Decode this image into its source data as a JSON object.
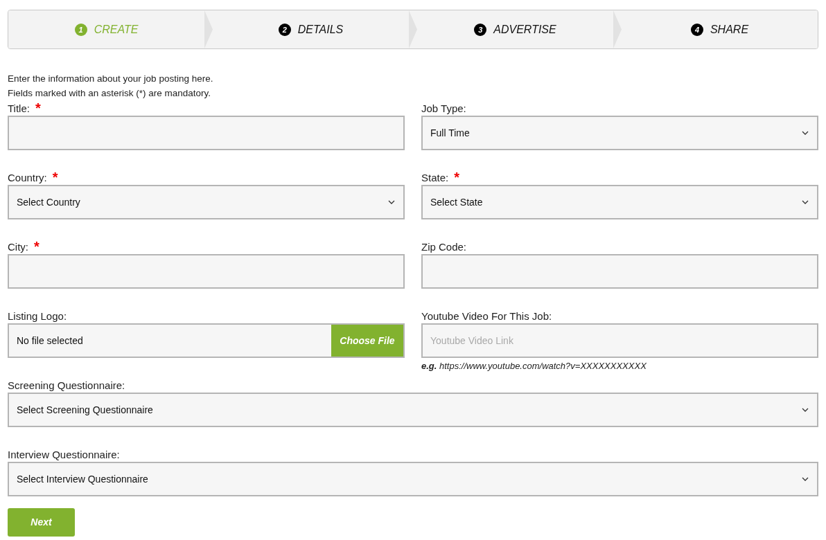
{
  "steps": [
    {
      "number": "1",
      "label": "CREATE",
      "selected": true
    },
    {
      "number": "2",
      "label": "DETAILS",
      "selected": false
    },
    {
      "number": "3",
      "label": "ADVERTISE",
      "selected": false
    },
    {
      "number": "4",
      "label": "SHARE",
      "selected": false
    }
  ],
  "intro": [
    "Enter the information about your job posting here.",
    "Fields marked with an asterisk (*) are mandatory."
  ],
  "rows": [
    [
      {
        "kind": "text",
        "label": "Title:",
        "required_mark": "*"
      },
      {
        "kind": "select",
        "label": "Job Type:",
        "value": "Full Time"
      }
    ],
    [
      {
        "kind": "select",
        "label": "Country:",
        "required_mark": "*",
        "value": "Select Country"
      },
      {
        "kind": "select",
        "label": "State:",
        "required_mark": "*",
        "value": "Select State"
      }
    ],
    [
      {
        "kind": "text",
        "label": "City:",
        "required_mark": "*"
      },
      {
        "kind": "text",
        "label": "Zip Code:"
      }
    ],
    [
      {
        "kind": "file",
        "label": "Listing Logo:",
        "value": "No file selected",
        "button": "Choose File"
      },
      {
        "kind": "text",
        "label": "Youtube Video For This Job:",
        "placeholder": "Youtube Video Link",
        "hint": "**e.g.** https://www.youtube.com/watch?v=XXXXXXXXXXX"
      }
    ],
    [
      {
        "kind": "select",
        "label": "Screening Questionnaire:",
        "value": "Select Screening Questionnaire"
      }
    ],
    [
      {
        "kind": "select",
        "label": "Interview Questionnaire:",
        "value": "Select Interview Questionnaire"
      }
    ]
  ],
  "next_button": "Next"
}
